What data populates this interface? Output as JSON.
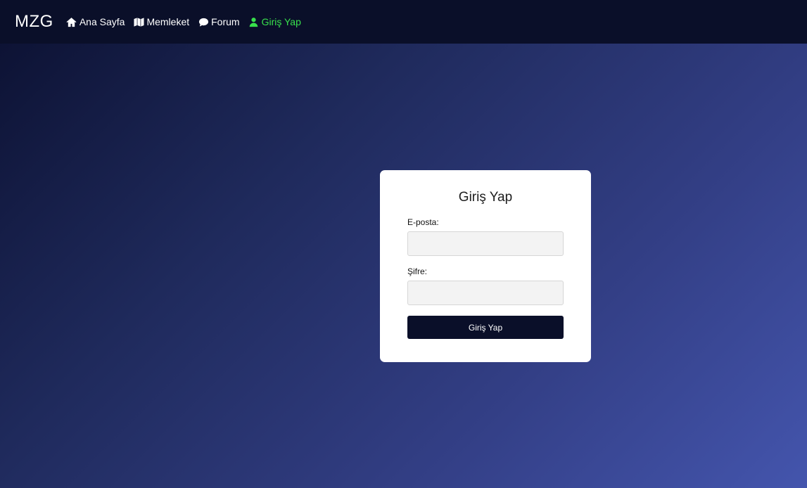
{
  "navbar": {
    "brand": "MZG",
    "items": [
      {
        "label": "Ana Sayfa",
        "icon": "home-icon",
        "active": false
      },
      {
        "label": "Memleket",
        "icon": "map-icon",
        "active": false
      },
      {
        "label": "Forum",
        "icon": "comment-icon",
        "active": false
      },
      {
        "label": "Giriş Yap",
        "icon": "user-icon",
        "active": true
      }
    ]
  },
  "login": {
    "title": "Giriş Yap",
    "email_label": "E-posta:",
    "email_value": "",
    "password_label": "Şifre:",
    "password_value": "",
    "submit_label": "Giriş Yap"
  },
  "colors": {
    "navbar_bg": "#0a0f29",
    "active_link": "#38e04c",
    "button_bg": "#0a0f29",
    "gradient_start": "#0b1030",
    "gradient_end": "#4455ad"
  }
}
